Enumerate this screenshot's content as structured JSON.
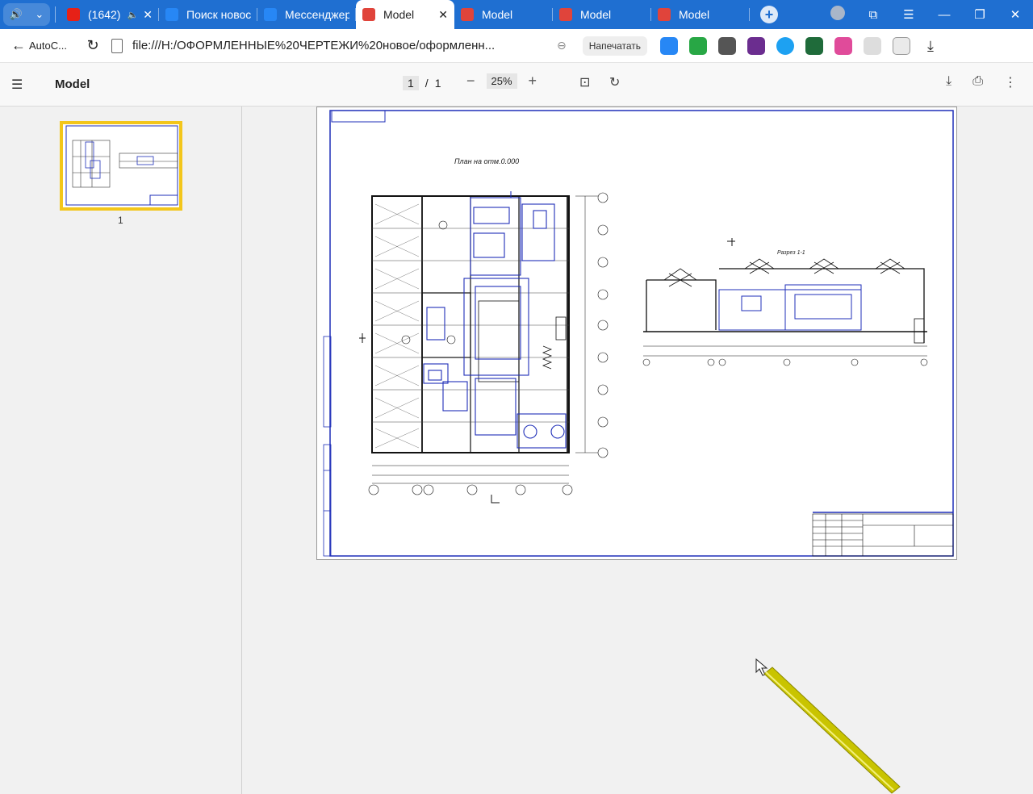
{
  "tabs": [
    {
      "title": "(1642)",
      "icon": "youtube-icon",
      "color": "#e62117",
      "sound": true,
      "close": true
    },
    {
      "title": "Поиск новост",
      "icon": "vk-icon",
      "color": "#2787f5"
    },
    {
      "title": "Мессенджер",
      "icon": "messenger-icon",
      "color": "#2787f5"
    },
    {
      "title": "Model",
      "icon": "pdf-icon",
      "color": "#e0443b",
      "active": true,
      "close": true
    },
    {
      "title": "Model",
      "icon": "pdf-icon",
      "color": "#e0443b"
    },
    {
      "title": "Model",
      "icon": "pdf-icon",
      "color": "#e0443b"
    },
    {
      "title": "Model",
      "icon": "pdf-icon",
      "color": "#e0443b"
    }
  ],
  "addressbar": {
    "back_label": "AutoC...",
    "url": "file:///H:/ОФОРМЛЕННЫЕ%20ЧЕРТЕЖИ%20новое/оформленн...",
    "print_label": "Напечатать"
  },
  "pdf": {
    "title": "Model",
    "page_current": "1",
    "page_sep": "/",
    "page_total": "1",
    "zoom": "25%",
    "thumb_label": "1"
  },
  "drawing": {
    "plan_title": "План на отм.0.000",
    "section_title": "Разрез 1-1"
  },
  "colors": {
    "tabstrip": "#1f6fd1",
    "thumb_border": "#f3c61b",
    "drawing_blue": "#1f2fb8"
  }
}
